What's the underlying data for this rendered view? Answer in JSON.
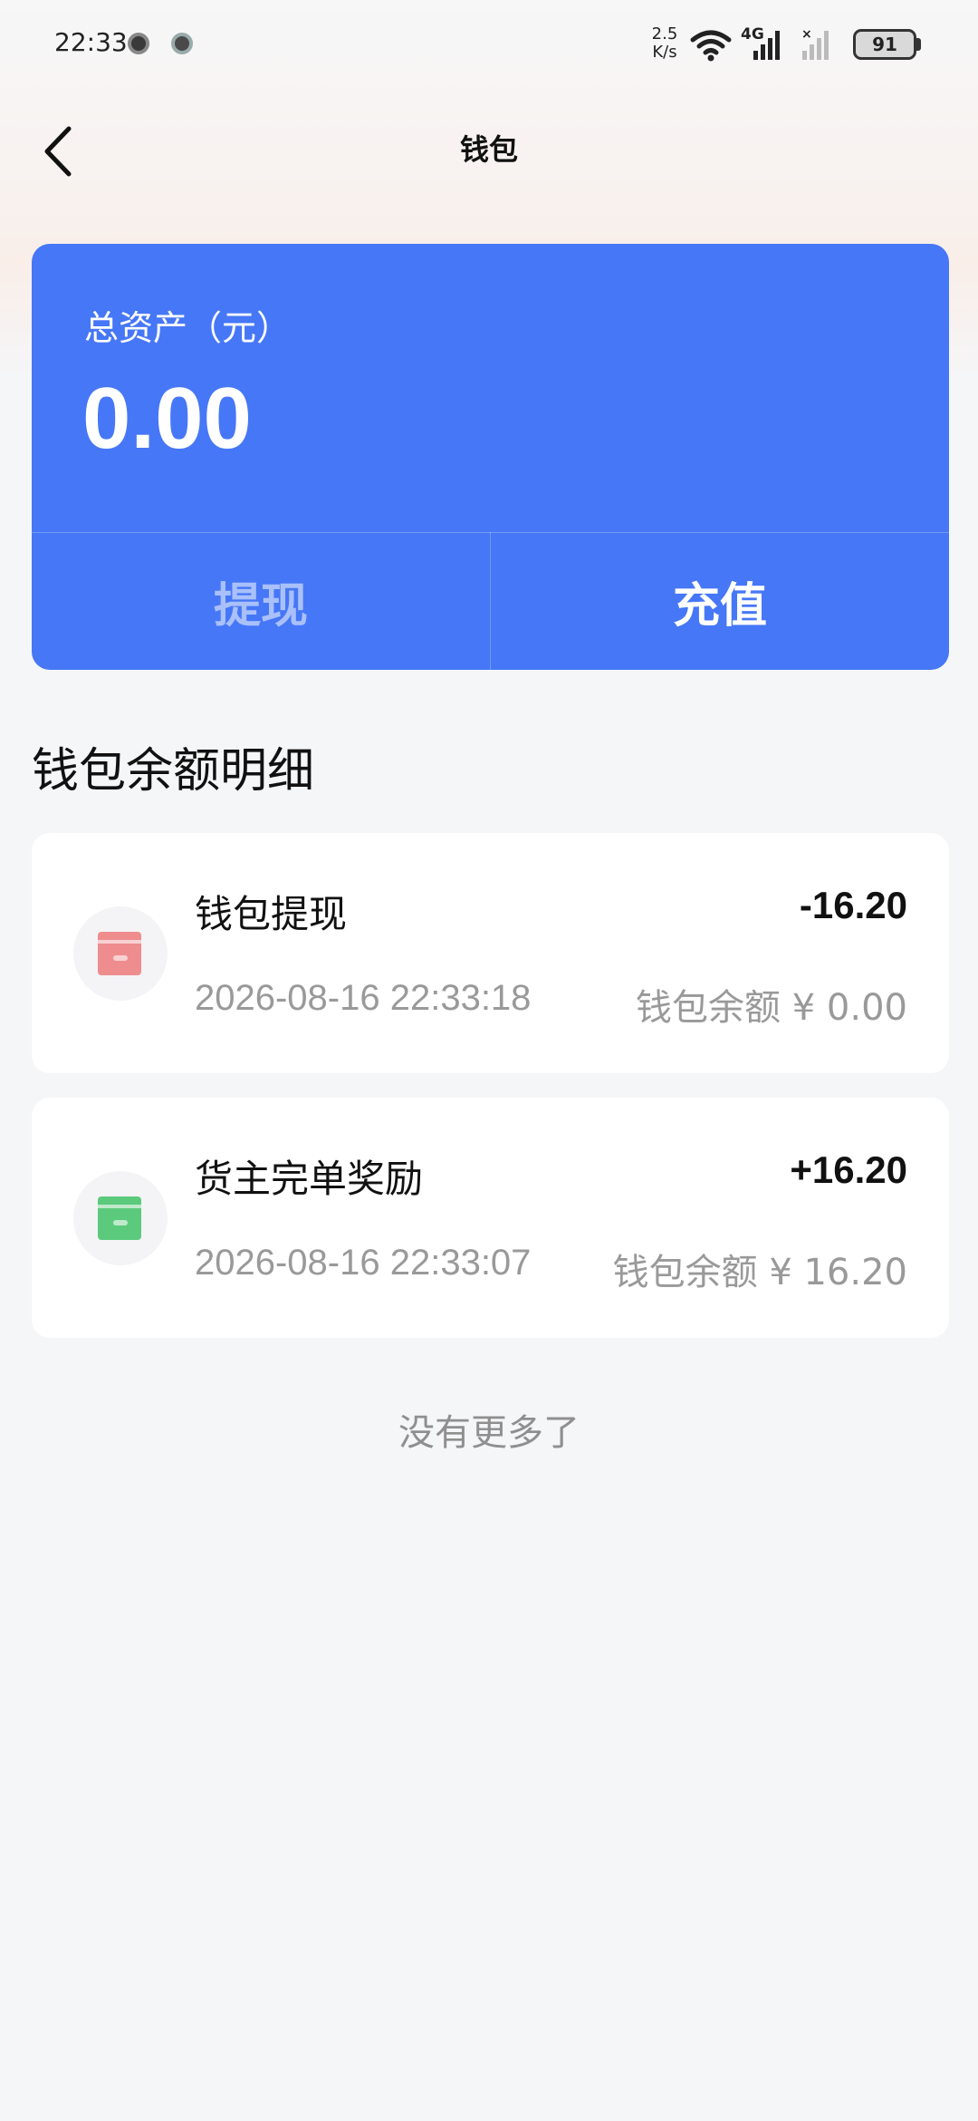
{
  "status_bar": {
    "time": "22:33",
    "net_speed_value": "2.5",
    "net_speed_unit": "K/s",
    "network_type": "4G",
    "battery": "91"
  },
  "nav": {
    "title": "钱包"
  },
  "asset_card": {
    "label": "总资产（元）",
    "amount": "0.00",
    "withdraw_label": "提现",
    "recharge_label": "充值"
  },
  "section": {
    "title": "钱包余额明细"
  },
  "records": [
    {
      "title": "钱包提现",
      "amount": "-16.20",
      "time": "2026-08-16 22:33:18",
      "balance": "钱包余额 ¥ 0.00"
    },
    {
      "title": "货主完单奖励",
      "amount": "+16.20",
      "time": "2026-08-16 22:33:07",
      "balance": "钱包余额 ¥ 16.20"
    }
  ],
  "footer": {
    "no_more": "没有更多了"
  },
  "colors": {
    "card_blue": "#4677f7",
    "withdraw_icon": "#ee8c8e",
    "income_icon": "#5cca7c",
    "background": "#f5f6f8"
  },
  "icons": [
    "back-arrow-icon",
    "wifi-icon",
    "signal-icon",
    "battery-icon",
    "withdraw-record-icon",
    "income-record-icon"
  ]
}
